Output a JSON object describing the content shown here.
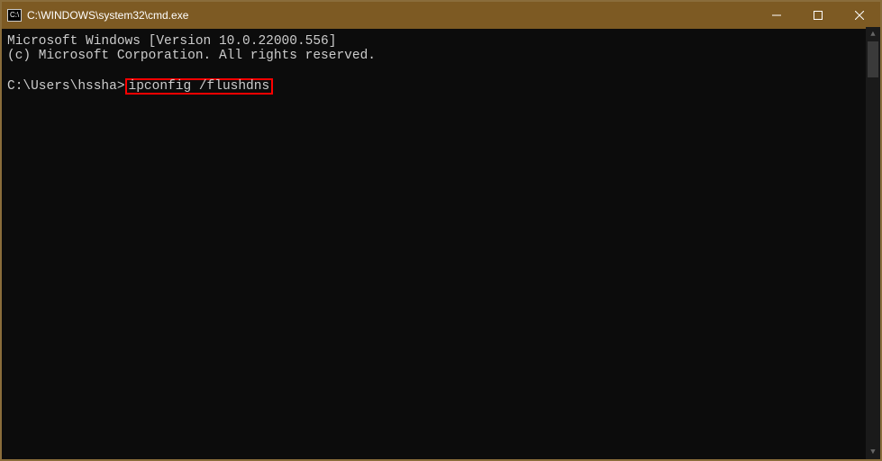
{
  "titlebar": {
    "icon_label": "C:\\",
    "title": "C:\\WINDOWS\\system32\\cmd.exe"
  },
  "terminal": {
    "line1": "Microsoft Windows [Version 10.0.22000.556]",
    "line2": "(c) Microsoft Corporation. All rights reserved.",
    "prompt": "C:\\Users\\hssha>",
    "command": "ipconfig /flushdns"
  }
}
